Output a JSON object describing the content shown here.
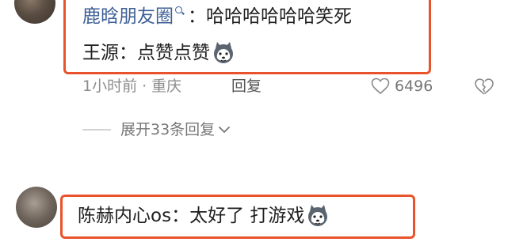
{
  "comment1": {
    "author": "鹿晗朋友圈",
    "separator": "：",
    "text": "哈哈哈哈哈哈笑死",
    "line2_author": "王源",
    "line2_separator": "：",
    "line2_text": "点赞点赞",
    "meta_time": "1小时前",
    "meta_dot": "·",
    "meta_location": "重庆",
    "reply_label": "回复",
    "like_count": "6496",
    "expand_label": "展开33条回复"
  },
  "comment2": {
    "author": "陈赫内心os",
    "separator": "：",
    "text": "太好了 打游戏"
  },
  "colors": {
    "highlight_border": "#e8532b",
    "author_link": "#3d5f96",
    "meta_gray": "#8c8c8c"
  },
  "icons": {
    "emoji": "husky-dog-emoji",
    "like": "heart-outline-icon",
    "dislike": "broken-heart-icon",
    "expand": "chevron-down-icon",
    "search": "search-icon"
  }
}
